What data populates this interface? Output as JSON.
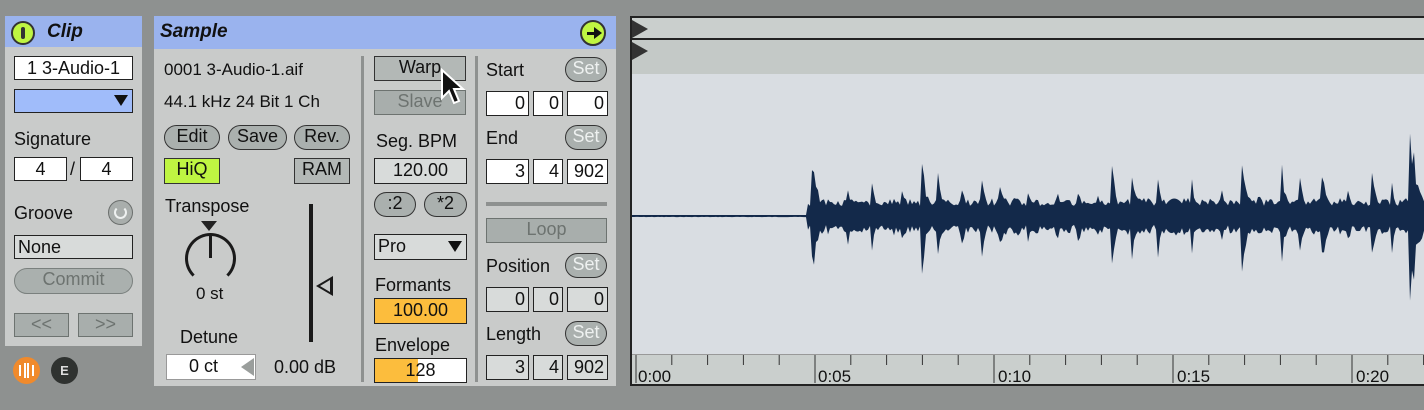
{
  "clip": {
    "title": "Clip",
    "name": "1 3-Audio-1",
    "signature_label": "Signature",
    "sig_num": "4",
    "sig_sep": "/",
    "sig_den": "4",
    "groove_label": "Groove",
    "groove_value": "None",
    "commit_label": "Commit",
    "prev_label": "<<",
    "next_label": ">>",
    "e_label": "E",
    "color_accent": "#a0bcfa"
  },
  "sample": {
    "title": "Sample",
    "filename": "0001 3-Audio-1.aif",
    "fileinfo": "44.1 kHz 24 Bit 1 Ch",
    "edit": "Edit",
    "save": "Save",
    "rev": "Rev.",
    "hiq": "HiQ",
    "ram": "RAM",
    "transpose_label": "Transpose",
    "transpose_value": "0 st",
    "detune_label": "Detune",
    "detune_value": "0 ct",
    "gain_value": "0.00 dB"
  },
  "warp": {
    "warp": "Warp",
    "slave": "Slave",
    "seg_bpm_label": "Seg. BPM",
    "seg_bpm_value": "120.00",
    "half": ":2",
    "double": "*2",
    "mode": "Pro",
    "formants_label": "Formants",
    "formants_value": "100.00",
    "envelope_label": "Envelope",
    "envelope_value": "128"
  },
  "markers": {
    "start_label": "Start",
    "set": "Set",
    "start": [
      "0",
      "0",
      "0"
    ],
    "end_label": "End",
    "end": [
      "3",
      "4",
      "902"
    ],
    "loop": "Loop",
    "position_label": "Position",
    "position": [
      "0",
      "0",
      "0"
    ],
    "length_label": "Length",
    "length": [
      "3",
      "4",
      "902"
    ]
  },
  "timeline": {
    "ticks": [
      "0:00",
      "0:05",
      "0:10",
      "0:15",
      "0:20"
    ]
  },
  "colors": {
    "header": "#9ab3ee",
    "panel": "#c9cbca",
    "hiq_on": "#bff542",
    "orange": "#fcbd3d",
    "waveform": "#13294a",
    "wave_bg": "#d9dde2"
  }
}
